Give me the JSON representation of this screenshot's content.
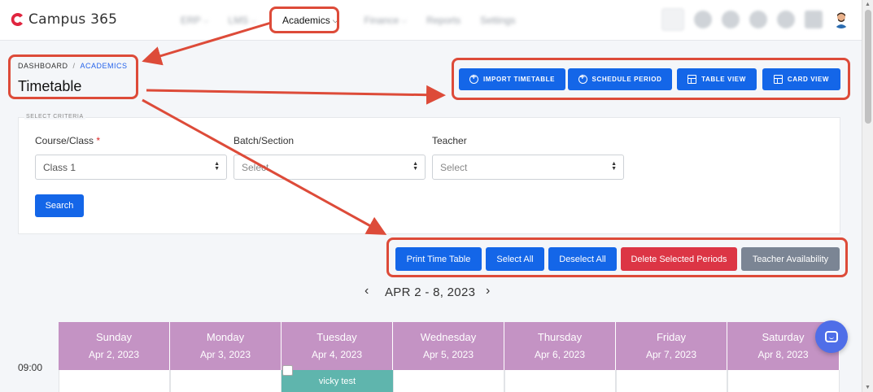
{
  "app": {
    "name": "Campus 365"
  },
  "nav": {
    "items": [
      {
        "label": "ERP",
        "blurred": true
      },
      {
        "label": "LMS",
        "blurred": true
      },
      {
        "label": "Academics",
        "active": true
      },
      {
        "label": "Finance",
        "blurred": true
      },
      {
        "label": "Reports",
        "blurred": true
      },
      {
        "label": "Settings",
        "blurred": true
      }
    ]
  },
  "breadcrumb": {
    "root": "DASHBOARD",
    "separator": "/",
    "current": "ACADEMICS"
  },
  "page": {
    "title": "Timetable"
  },
  "header_buttons": {
    "import": "IMPORT TIMETABLE",
    "schedule": "SCHEDULE PERIOD",
    "table_view": "TABLE VIEW",
    "card_view": "CARD VIEW"
  },
  "criteria": {
    "legend": "SELECT CRITERIA",
    "course_label": "Course/Class",
    "required_mark": "*",
    "course_value": "Class 1",
    "batch_label": "Batch/Section",
    "batch_placeholder": "Select",
    "teacher_label": "Teacher",
    "teacher_placeholder": "Select",
    "search_label": "Search"
  },
  "actions": {
    "print": "Print Time Table",
    "select_all": "Select All",
    "deselect_all": "Deselect All",
    "delete_selected": "Delete Selected Periods",
    "teacher_availability": "Teacher Availability"
  },
  "week": {
    "range": "APR 2 - 8, 2023",
    "prev": "‹",
    "next": "›"
  },
  "calendar": {
    "days": [
      {
        "name": "Sunday",
        "date": "Apr 2, 2023"
      },
      {
        "name": "Monday",
        "date": "Apr 3, 2023"
      },
      {
        "name": "Tuesday",
        "date": "Apr 4, 2023"
      },
      {
        "name": "Wednesday",
        "date": "Apr 5, 2023"
      },
      {
        "name": "Thursday",
        "date": "Apr 6, 2023"
      },
      {
        "name": "Friday",
        "date": "Apr 7, 2023"
      },
      {
        "name": "Saturday",
        "date": "Apr 8, 2023"
      }
    ],
    "time": "09:00",
    "event": {
      "title": "vicky test",
      "day": "Tuesday"
    }
  },
  "colors": {
    "primary": "#1466e8",
    "danger": "#dc3545",
    "secondary": "#7b8594",
    "day_header": "#c493c4",
    "event": "#5fb5ad",
    "annotation": "#dd4b39",
    "brand": "#e0253f"
  }
}
